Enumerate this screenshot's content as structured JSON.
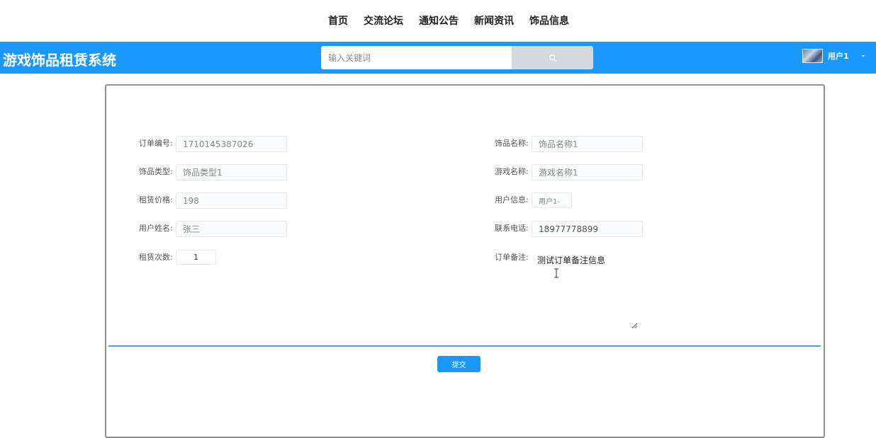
{
  "top_nav": {
    "items": [
      "首页",
      "交流论坛",
      "通知公告",
      "新闻资讯",
      "饰品信息"
    ]
  },
  "header": {
    "app_title": "游戏饰品租赁系统",
    "search_placeholder": "输入关键词",
    "user_name": "用户1",
    "bg_color": "#1a98ff"
  },
  "form": {
    "order_no": {
      "label": "订单编号:",
      "value": "1710145387026"
    },
    "item_name": {
      "label": "饰品名称:",
      "value": "饰品名称1"
    },
    "item_type": {
      "label": "饰品类型:",
      "value": "饰品类型1"
    },
    "game_name": {
      "label": "游戏名称:",
      "value": "游戏名称1"
    },
    "rent_price": {
      "label": "租赁价格:",
      "value": "198"
    },
    "user_info": {
      "label": "用户信息:",
      "value": "用户1-"
    },
    "user_real_name": {
      "label": "用户姓名:",
      "value": "张三"
    },
    "phone": {
      "label": "联系电话:",
      "value": "18977778899"
    },
    "rent_count": {
      "label": "租赁次数:",
      "value": "1"
    },
    "remark": {
      "label": "订单备注:",
      "value": "测试订单备注信息"
    }
  },
  "submit_label": "提交",
  "icons": {
    "search": "search-icon",
    "user_dropdown": "caret-down-icon",
    "text_cursor": "text-cursor-icon"
  }
}
